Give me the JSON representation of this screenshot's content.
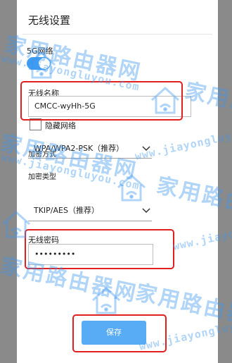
{
  "dialog": {
    "title": "无线设置",
    "band_label": "5G网络",
    "band_toggle_on": true,
    "ssid_label": "无线名称",
    "ssid_value": "CMCC-wyHh-5G",
    "hide_network_label": "隐藏网络",
    "hide_network_checked": false,
    "encryption_label": "加密方式",
    "encryption_value": "WPA/WPA2-PSK（推荐）",
    "encryption_type_label": "加密类型",
    "encryption_type_value": "TKIP/AES（推荐）",
    "password_label": "无线密码",
    "password_value": "•••••••••",
    "save_label": "保存"
  },
  "watermark": {
    "brand_cn": "家用路由器网",
    "site_en": "www.jiayongluyou.com"
  },
  "colors": {
    "accent": "#3f9cf2",
    "button": "#58abf5",
    "highlight": "#e02020",
    "watermark": "#3a96f0"
  }
}
